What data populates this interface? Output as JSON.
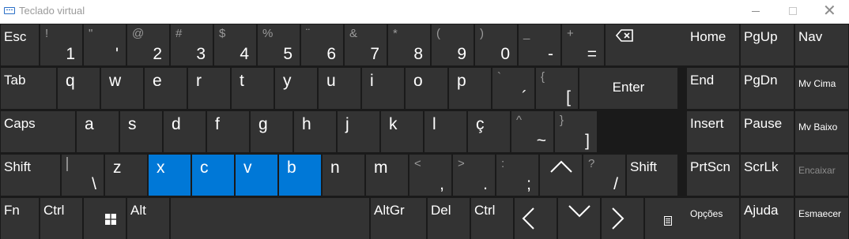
{
  "window": {
    "title": "Teclado virtual",
    "icon": "keyboard-icon"
  },
  "rows": [
    [
      {
        "id": "esc",
        "label": "Esc"
      },
      {
        "id": "1",
        "shift": "!",
        "main": "1"
      },
      {
        "id": "quote",
        "shift": "\"",
        "main": "'"
      },
      {
        "id": "2",
        "shift": "@",
        "main": "2"
      },
      {
        "id": "3",
        "shift": "#",
        "main": "3"
      },
      {
        "id": "4",
        "shift": "$",
        "main": "4"
      },
      {
        "id": "5",
        "shift": "%",
        "main": "5"
      },
      {
        "id": "6",
        "shift": "¨",
        "main": "6"
      },
      {
        "id": "7",
        "shift": "&",
        "main": "7"
      },
      {
        "id": "8",
        "shift": "*",
        "main": "8"
      },
      {
        "id": "9",
        "shift": "(",
        "main": "9"
      },
      {
        "id": "0",
        "shift": ")",
        "main": "0"
      },
      {
        "id": "minus",
        "shift": "_",
        "main": "-"
      },
      {
        "id": "equals",
        "shift": "+",
        "main": "="
      },
      {
        "id": "backspace",
        "icon": "backspace-icon"
      }
    ],
    [
      {
        "id": "tab",
        "label": "Tab"
      },
      {
        "id": "q",
        "label": "q"
      },
      {
        "id": "w",
        "label": "w"
      },
      {
        "id": "e",
        "label": "e"
      },
      {
        "id": "r",
        "label": "r"
      },
      {
        "id": "t",
        "label": "t"
      },
      {
        "id": "y",
        "label": "y"
      },
      {
        "id": "u",
        "label": "u"
      },
      {
        "id": "i",
        "label": "i"
      },
      {
        "id": "o",
        "label": "o"
      },
      {
        "id": "p",
        "label": "p"
      },
      {
        "id": "acute",
        "shift": "`",
        "main": "´"
      },
      {
        "id": "bracketleft",
        "shift": "{",
        "main": "["
      },
      {
        "id": "enter",
        "label": "Enter"
      }
    ],
    [
      {
        "id": "caps",
        "label": "Caps"
      },
      {
        "id": "a",
        "label": "a"
      },
      {
        "id": "s",
        "label": "s"
      },
      {
        "id": "d",
        "label": "d"
      },
      {
        "id": "f",
        "label": "f"
      },
      {
        "id": "g",
        "label": "g"
      },
      {
        "id": "h",
        "label": "h"
      },
      {
        "id": "j",
        "label": "j"
      },
      {
        "id": "k",
        "label": "k"
      },
      {
        "id": "l",
        "label": "l"
      },
      {
        "id": "cedilla",
        "label": "ç"
      },
      {
        "id": "tilde",
        "shift": "^",
        "main": "~"
      },
      {
        "id": "bracketright",
        "shift": "}",
        "main": "]"
      }
    ],
    [
      {
        "id": "lshift",
        "label": "Shift"
      },
      {
        "id": "backslash",
        "shift": "|",
        "main": "\\"
      },
      {
        "id": "z",
        "label": "z"
      },
      {
        "id": "x",
        "label": "x",
        "selected": true
      },
      {
        "id": "c",
        "label": "c",
        "selected": true
      },
      {
        "id": "v",
        "label": "v",
        "selected": true
      },
      {
        "id": "b",
        "label": "b",
        "selected": true
      },
      {
        "id": "n",
        "label": "n"
      },
      {
        "id": "m",
        "label": "m"
      },
      {
        "id": "comma",
        "shift": "<",
        "main": ","
      },
      {
        "id": "period",
        "shift": ">",
        "main": "."
      },
      {
        "id": "semicolon",
        "shift": ":",
        "main": ";"
      },
      {
        "id": "up",
        "icon": "arrow-up-icon"
      },
      {
        "id": "slash",
        "shift": "?",
        "main": "/"
      },
      {
        "id": "rshift",
        "label": "Shift"
      }
    ],
    [
      {
        "id": "fn",
        "label": "Fn"
      },
      {
        "id": "ctrl",
        "label": "Ctrl"
      },
      {
        "id": "win",
        "icon": "windows-logo-icon"
      },
      {
        "id": "alt",
        "label": "Alt"
      },
      {
        "id": "space",
        "label": ""
      },
      {
        "id": "altgr",
        "label": "AltGr"
      },
      {
        "id": "del",
        "label": "Del"
      },
      {
        "id": "rctrl",
        "label": "Ctrl"
      },
      {
        "id": "left",
        "icon": "arrow-left-icon"
      },
      {
        "id": "down",
        "icon": "arrow-down-icon"
      },
      {
        "id": "right",
        "icon": "arrow-right-icon"
      },
      {
        "id": "menu",
        "icon": "context-menu-icon"
      }
    ]
  ],
  "nav": [
    [
      {
        "id": "home",
        "label": "Home"
      },
      {
        "id": "pgup",
        "label": "PgUp"
      },
      {
        "id": "nav",
        "label": "Nav"
      }
    ],
    [
      {
        "id": "end",
        "label": "End"
      },
      {
        "id": "pgdn",
        "label": "PgDn"
      },
      {
        "id": "mvcima",
        "label": "Mv Cima"
      }
    ],
    [
      {
        "id": "insert",
        "label": "Insert"
      },
      {
        "id": "pause",
        "label": "Pause"
      },
      {
        "id": "mvbaixo",
        "label": "Mv Baixo"
      }
    ],
    [
      {
        "id": "prtscn",
        "label": "PrtScn"
      },
      {
        "id": "scrlk",
        "label": "ScrLk"
      },
      {
        "id": "encaixar",
        "label": "Encaixar"
      }
    ],
    [
      {
        "id": "opcoes",
        "label": "Opções"
      },
      {
        "id": "ajuda",
        "label": "Ajuda"
      },
      {
        "id": "esmaecer",
        "label": "Esmaecer"
      }
    ]
  ],
  "colors": {
    "key": "#333333",
    "selected": "#0078d7",
    "background": "#1a1a1a",
    "secondary_text": "#9a9a9a"
  }
}
